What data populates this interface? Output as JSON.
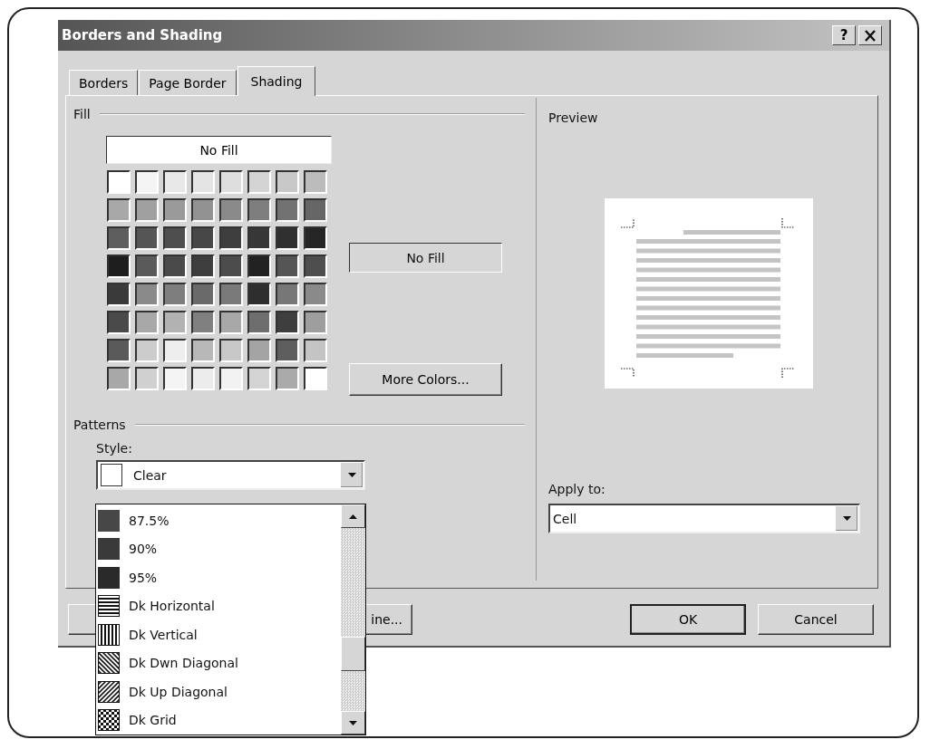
{
  "window": {
    "title": "Borders and Shading",
    "help_button": "?"
  },
  "tabs": [
    {
      "label": "Borders",
      "selected": false
    },
    {
      "label": "Page Border",
      "selected": false
    },
    {
      "label": "Shading",
      "selected": true
    }
  ],
  "fill": {
    "label": "Fill",
    "no_fill_button": "No Fill",
    "current": "No Fill",
    "more_colors_button": "More Colors...",
    "swatch_rows": [
      [
        {
          "color": "#ffffff"
        },
        {
          "color": "#f4f4f4"
        },
        {
          "color": "#e8e8e8"
        },
        {
          "color": "#e4e4e4"
        },
        {
          "color": "#dedede"
        },
        {
          "color": "#d4d4d4"
        },
        {
          "color": "#c8c8c8"
        },
        {
          "color": "#bcbcbc"
        }
      ],
      [
        {
          "color": "#a8a8a8"
        },
        {
          "color": "#a0a0a0"
        },
        {
          "color": "#9a9a9a"
        },
        {
          "color": "#929292"
        },
        {
          "color": "#8a8a8a"
        },
        {
          "color": "#7e7e7e"
        },
        {
          "color": "#727272"
        },
        {
          "color": "#666666"
        }
      ],
      [
        {
          "color": "#5e5e5e"
        },
        {
          "color": "#555555"
        },
        {
          "color": "#4e4e4e"
        },
        {
          "color": "#474747"
        },
        {
          "color": "#3e3e3e"
        },
        {
          "color": "#373737"
        },
        {
          "color": "#303030"
        },
        {
          "color": "#262626"
        }
      ],
      [
        {
          "color": "#1e1e1e"
        },
        {
          "color": "#5a5a5a"
        },
        {
          "color": "#4a4a4a"
        },
        {
          "color": "#3e3e3e"
        },
        {
          "color": "#4c4c4c"
        },
        {
          "color": "#222222"
        },
        {
          "color": "#555555"
        },
        {
          "color": "#4e4e4e"
        }
      ],
      [
        {
          "color": "#3a3a3a"
        },
        {
          "color": "#8a8a8a"
        },
        {
          "color": "#7e7e7e"
        },
        {
          "color": "#6a6a6a"
        },
        {
          "color": "#7a7a7a"
        },
        {
          "color": "#2e2e2e"
        },
        {
          "color": "#777777"
        },
        {
          "color": "#8a8a8a"
        }
      ],
      [
        {
          "color": "#4a4a4a"
        },
        {
          "color": "#a8a8a8"
        },
        {
          "color": "#b2b2b2"
        },
        {
          "color": "#808080"
        },
        {
          "color": "#a8a8a8"
        },
        {
          "color": "#6e6e6e"
        },
        {
          "color": "#3e3e3e"
        },
        {
          "color": "#9e9e9e"
        }
      ],
      [
        {
          "color": "#5a5a5a"
        },
        {
          "color": "#cccccc"
        },
        {
          "color": "#eeeeee"
        },
        {
          "color": "#b8b8b8"
        },
        {
          "color": "#c8c8c8"
        },
        {
          "color": "#a4a4a4"
        },
        {
          "color": "#5e5e5e"
        },
        {
          "color": "#c4c4c4"
        }
      ],
      [
        {
          "color": "#a8a8a8"
        },
        {
          "color": "#d0d0d0"
        },
        {
          "color": "#f4f4f4"
        },
        {
          "color": "#ececec"
        },
        {
          "color": "#f2f2f2"
        },
        {
          "color": "#d4d4d4"
        },
        {
          "color": "#aaaaaa"
        },
        {
          "color": "#ffffff"
        }
      ]
    ]
  },
  "patterns": {
    "label": "Patterns",
    "style_label": "Style:",
    "style_value": "Clear",
    "style_list": [
      {
        "label": "87.5%",
        "kind": "shade",
        "color": "#474747"
      },
      {
        "label": "90%",
        "kind": "shade",
        "color": "#3a3a3a"
      },
      {
        "label": "95%",
        "kind": "shade",
        "color": "#2a2a2a"
      },
      {
        "label": "Dk Horizontal",
        "kind": "horizontal"
      },
      {
        "label": "Dk Vertical",
        "kind": "vertical"
      },
      {
        "label": "Dk Dwn Diagonal",
        "kind": "down-diagonal"
      },
      {
        "label": "Dk Up Diagonal",
        "kind": "up-diagonal"
      },
      {
        "label": "Dk Grid",
        "kind": "grid"
      }
    ]
  },
  "preview": {
    "label": "Preview",
    "apply_to_label": "Apply to:",
    "apply_to_value": "Cell"
  },
  "footer_buttons": [
    {
      "label": "ine...",
      "default": false
    },
    {
      "label": "OK",
      "default": true
    },
    {
      "label": "Cancel",
      "default": false
    }
  ]
}
